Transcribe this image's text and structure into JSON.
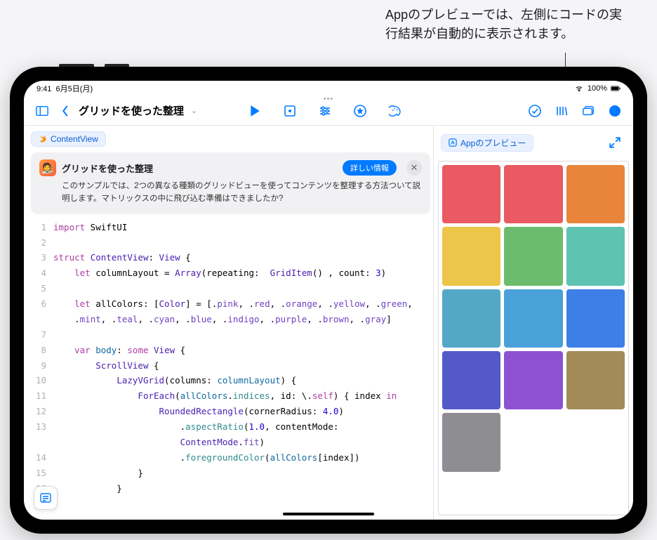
{
  "annotation": {
    "line1": "Appのプレビューでは、左側にコードの実",
    "line2": "行結果が自動的に表示されます。"
  },
  "status": {
    "time": "9:41",
    "date": "6月5日(月)",
    "battery": "100%"
  },
  "toolbar": {
    "title": "グリッドを使った整理"
  },
  "breadcrumb": {
    "label": "ContentView"
  },
  "banner": {
    "title": "グリッドを使った整理",
    "more_label": "詳しい情報",
    "desc": "このサンプルでは、2つの異なる種類のグリッドビューを使ってコンテンツを整理する方法ついて説明します。マトリックスの中に飛び込む準備はできましたか?"
  },
  "preview": {
    "label": "Appのプレビュー",
    "grid_colors": [
      "#e95a62",
      "#e95a62",
      "#e8853b",
      "#ecc549",
      "#6bbd6d",
      "#5fc3b1",
      "#54a8c7",
      "#4aa0d8",
      "#3d7fe6",
      "#5459c9",
      "#8d52d1",
      "#a38a57",
      "#8d8d92"
    ]
  },
  "code": {
    "lines": [
      {
        "n": "1",
        "seg": [
          {
            "c": "kw",
            "t": "import"
          },
          {
            "t": " SwiftUI"
          }
        ]
      },
      {
        "n": "2",
        "seg": []
      },
      {
        "n": "3",
        "seg": [
          {
            "c": "kw",
            "t": "struct"
          },
          {
            "t": " "
          },
          {
            "c": "type",
            "t": "ContentView"
          },
          {
            "t": ": "
          },
          {
            "c": "type",
            "t": "View"
          },
          {
            "t": " {"
          }
        ]
      },
      {
        "n": "4",
        "seg": [
          {
            "t": "    "
          },
          {
            "c": "kw",
            "t": "let"
          },
          {
            "t": " columnLayout = "
          },
          {
            "c": "type",
            "t": "Array"
          },
          {
            "t": "(repeating:  "
          },
          {
            "c": "type",
            "t": "GridItem"
          },
          {
            "t": "() , count: "
          },
          {
            "c": "num",
            "t": "3"
          },
          {
            "t": ")"
          }
        ]
      },
      {
        "n": "5",
        "seg": []
      },
      {
        "n": "6",
        "seg": [
          {
            "t": "    "
          },
          {
            "c": "kw",
            "t": "let"
          },
          {
            "t": " allColors: ["
          },
          {
            "c": "type",
            "t": "Color"
          },
          {
            "t": "] = [."
          },
          {
            "c": "enumcase",
            "t": "pink"
          },
          {
            "t": ", ."
          },
          {
            "c": "enumcase",
            "t": "red"
          },
          {
            "t": ", ."
          },
          {
            "c": "enumcase",
            "t": "orange"
          },
          {
            "t": ", ."
          },
          {
            "c": "enumcase",
            "t": "yellow"
          },
          {
            "t": ", ."
          },
          {
            "c": "enumcase",
            "t": "green"
          },
          {
            "t": ","
          }
        ]
      },
      {
        "n": "",
        "seg": [
          {
            "t": "    ."
          },
          {
            "c": "enumcase",
            "t": "mint"
          },
          {
            "t": ", ."
          },
          {
            "c": "enumcase",
            "t": "teal"
          },
          {
            "t": ", ."
          },
          {
            "c": "enumcase",
            "t": "cyan"
          },
          {
            "t": ", ."
          },
          {
            "c": "enumcase",
            "t": "blue"
          },
          {
            "t": ", ."
          },
          {
            "c": "enumcase",
            "t": "indigo"
          },
          {
            "t": ", ."
          },
          {
            "c": "enumcase",
            "t": "purple"
          },
          {
            "t": ", ."
          },
          {
            "c": "enumcase",
            "t": "brown"
          },
          {
            "t": ", ."
          },
          {
            "c": "enumcase",
            "t": "gray"
          },
          {
            "t": "]"
          }
        ]
      },
      {
        "n": "7",
        "seg": []
      },
      {
        "n": "8",
        "seg": [
          {
            "t": "    "
          },
          {
            "c": "kw",
            "t": "var"
          },
          {
            "t": " "
          },
          {
            "c": "ident",
            "t": "body"
          },
          {
            "t": ": "
          },
          {
            "c": "kw",
            "t": "some"
          },
          {
            "t": " "
          },
          {
            "c": "type",
            "t": "View"
          },
          {
            "t": " {"
          }
        ]
      },
      {
        "n": "9",
        "seg": [
          {
            "t": "        "
          },
          {
            "c": "type",
            "t": "ScrollView"
          },
          {
            "t": " {"
          }
        ]
      },
      {
        "n": "10",
        "seg": [
          {
            "t": "            "
          },
          {
            "c": "type",
            "t": "LazyVGrid"
          },
          {
            "t": "(columns: "
          },
          {
            "c": "ident",
            "t": "columnLayout"
          },
          {
            "t": ") {"
          }
        ]
      },
      {
        "n": "11",
        "seg": [
          {
            "t": "                "
          },
          {
            "c": "type",
            "t": "ForEach"
          },
          {
            "t": "("
          },
          {
            "c": "ident",
            "t": "allColors"
          },
          {
            "t": "."
          },
          {
            "c": "method",
            "t": "indices"
          },
          {
            "t": ", id: \\."
          },
          {
            "c": "kw",
            "t": "self"
          },
          {
            "t": ") { index "
          },
          {
            "c": "kw",
            "t": "in"
          }
        ]
      },
      {
        "n": "12",
        "seg": [
          {
            "t": "                    "
          },
          {
            "c": "type",
            "t": "RoundedRectangle"
          },
          {
            "t": "(cornerRadius: "
          },
          {
            "c": "num",
            "t": "4.0"
          },
          {
            "t": ")"
          }
        ]
      },
      {
        "n": "13",
        "seg": [
          {
            "t": "                        ."
          },
          {
            "c": "method",
            "t": "aspectRatio"
          },
          {
            "t": "("
          },
          {
            "c": "num",
            "t": "1.0"
          },
          {
            "t": ", contentMode: "
          }
        ]
      },
      {
        "n": "",
        "seg": [
          {
            "t": "                        "
          },
          {
            "c": "type",
            "t": "ContentMode"
          },
          {
            "t": "."
          },
          {
            "c": "enumcase",
            "t": "fit"
          },
          {
            "t": ")"
          }
        ]
      },
      {
        "n": "14",
        "seg": [
          {
            "t": "                        ."
          },
          {
            "c": "method",
            "t": "foregroundColor"
          },
          {
            "t": "("
          },
          {
            "c": "ident",
            "t": "allColors"
          },
          {
            "t": "[index])"
          }
        ]
      },
      {
        "n": "15",
        "seg": [
          {
            "t": "                }"
          }
        ]
      },
      {
        "n": "16",
        "seg": [
          {
            "t": "            }"
          }
        ]
      }
    ]
  }
}
